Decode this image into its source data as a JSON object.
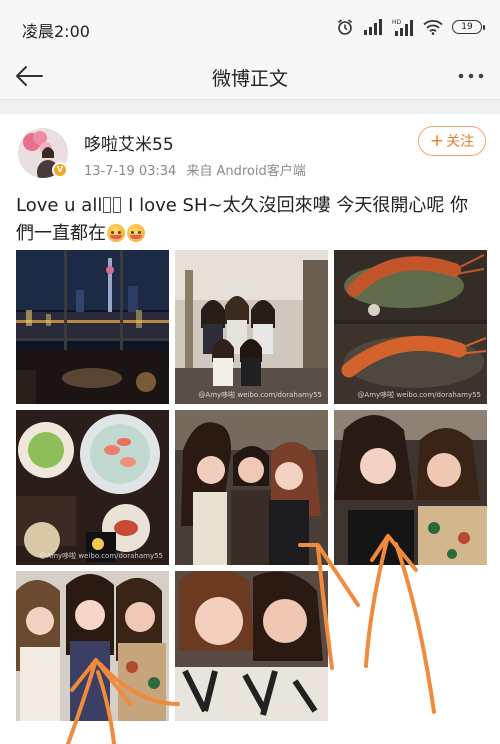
{
  "status_bar": {
    "time": "凌晨2:00",
    "battery": "19",
    "icons": [
      "alarm-icon",
      "signal-icon",
      "hd-signal-icon",
      "wifi-icon",
      "battery-icon"
    ]
  },
  "nav": {
    "title": "微博正文",
    "back_icon": "back-arrow-icon",
    "more_icon": "more-icon"
  },
  "post": {
    "author": "哆啦艾米55",
    "date": "13-7-19 03:34",
    "source": "来自 Android客户端",
    "follow_label": "关注",
    "text_a": "Love u all",
    "text_b": " I love SH~太久沒回來嘍 今天很開心呢 你們一直都在"
  },
  "photos": [
    {
      "name": "night-view-photo",
      "watermark": ""
    },
    {
      "name": "group-photo-room",
      "watermark": "@Amy哆啦 weibo.com/dorahamy55"
    },
    {
      "name": "lobster-dish-photo",
      "watermark": "@Amy哆啦 weibo.com/dorahamy55"
    },
    {
      "name": "sashimi-dinner-photo",
      "watermark": "@Amy哆啦 weibo.com/dorahamy55"
    },
    {
      "name": "friends-selfie-group-photo",
      "watermark": ""
    },
    {
      "name": "two-friends-selfie-photo",
      "watermark": ""
    },
    {
      "name": "three-friends-photo",
      "watermark": ""
    },
    {
      "name": "close-selfie-photo",
      "watermark": ""
    }
  ],
  "colors": {
    "accent": "#e3802e",
    "annotation": "#f08a3c",
    "meta_text": "#8a8a8a"
  }
}
